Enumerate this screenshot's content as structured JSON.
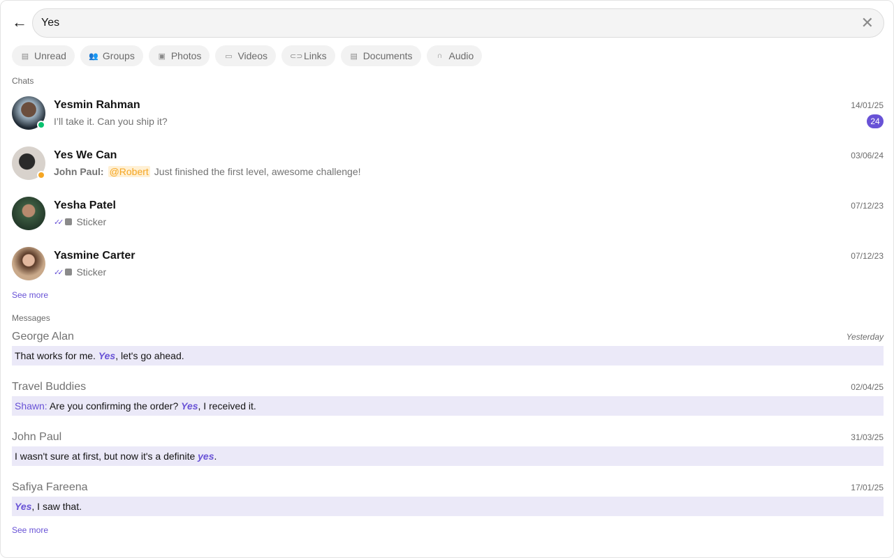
{
  "search": {
    "value": "Yes"
  },
  "filters": [
    {
      "label": "Unread",
      "icon": "unread-icon"
    },
    {
      "label": "Groups",
      "icon": "groups-icon"
    },
    {
      "label": "Photos",
      "icon": "photo-icon"
    },
    {
      "label": "Videos",
      "icon": "video-icon"
    },
    {
      "label": "Links",
      "icon": "link-icon"
    },
    {
      "label": "Documents",
      "icon": "document-icon"
    },
    {
      "label": "Audio",
      "icon": "headphones-icon"
    }
  ],
  "chats_label": "Chats",
  "chats": [
    {
      "name": "Yesmin Rahman",
      "preview": "I’ll take it. Can you ship it?",
      "date": "14/01/25",
      "badge": "24"
    },
    {
      "name": "Yes We Can",
      "sender": "John Paul:",
      "mention": "@Robert",
      "preview": "Just finished the first level, awesome challenge!",
      "date": "03/06/24"
    },
    {
      "name": "Yesha Patel",
      "preview": "Sticker",
      "date": "07/12/23"
    },
    {
      "name": "Yasmine Carter",
      "preview": "Sticker",
      "date": "07/12/23"
    }
  ],
  "see_more": "See more",
  "messages_label": "Messages",
  "messages": [
    {
      "name": "George Alan",
      "date": "Yesterday",
      "pre": "That works for me. ",
      "hl": "Yes",
      "post": ", let's go ahead."
    },
    {
      "name": "Travel Buddies",
      "date": "02/04/25",
      "sender": "Shawn:",
      "pre": " Are you confirming the order? ",
      "hl": "Yes",
      "post": ", I received it."
    },
    {
      "name": "John Paul",
      "date": "31/03/25",
      "pre": "I wasn't sure at first, but now it's a definite ",
      "hl": "yes",
      "post": "."
    },
    {
      "name": "Safiya Fareena",
      "date": "17/01/25",
      "pre": "",
      "hl": "Yes",
      "post": ", I saw that."
    }
  ],
  "colors": {
    "accent": "#6852d6",
    "online": "#09c26f",
    "mention": "#f5a623"
  }
}
